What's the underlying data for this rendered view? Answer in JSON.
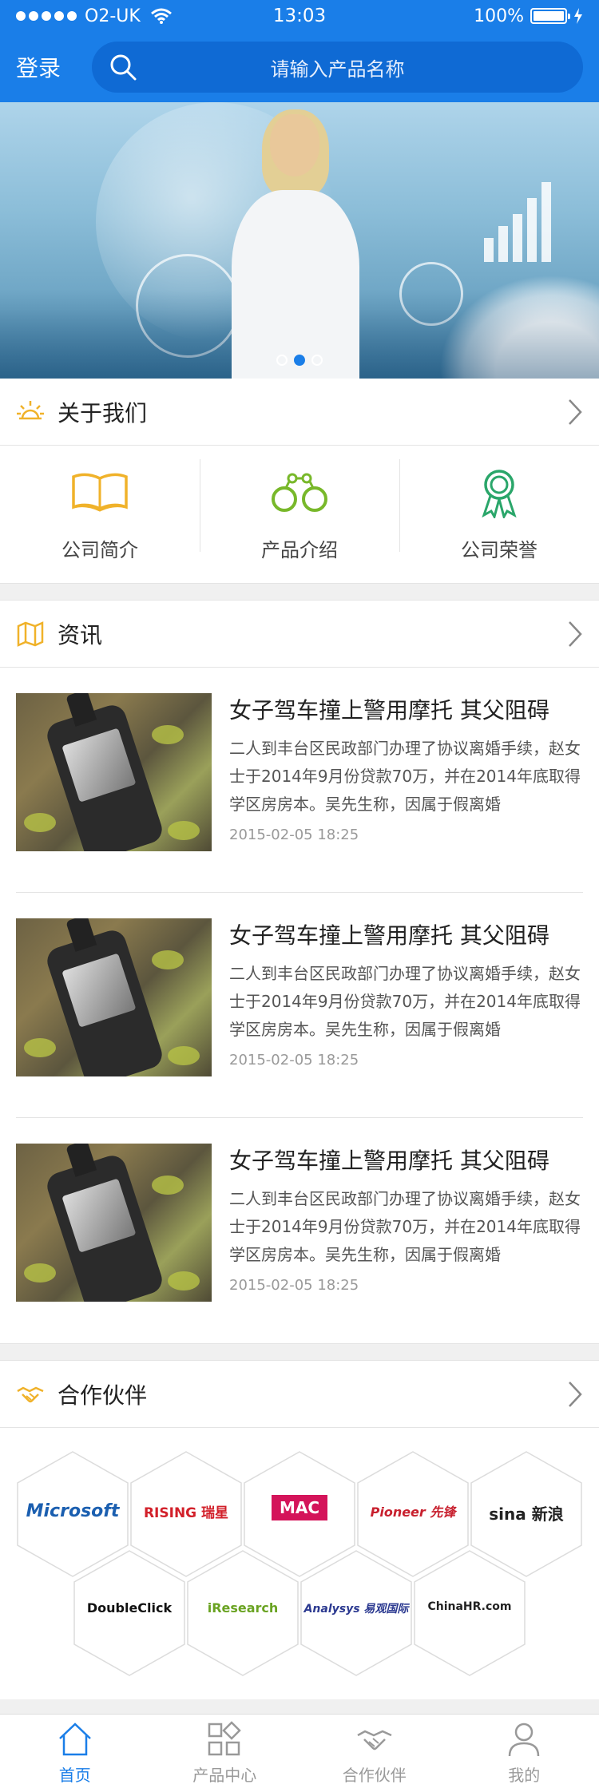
{
  "status_bar": {
    "carrier": "O2-UK",
    "time": "13:03",
    "battery": "100%"
  },
  "header": {
    "login_label": "登录",
    "search_placeholder": "请输入产品名称"
  },
  "banner": {
    "slides": 3,
    "active_slide": 2
  },
  "about": {
    "title": "关于我们",
    "items": [
      {
        "label": "公司简介",
        "icon": "book-icon"
      },
      {
        "label": "产品介绍",
        "icon": "handcuffs-icon"
      },
      {
        "label": "公司荣誉",
        "icon": "award-ribbon-icon"
      }
    ]
  },
  "news": {
    "title": "资讯",
    "items": [
      {
        "title": "女子驾车撞上警用摩托 其父阻碍",
        "desc_line1": "二人到丰台区民政部门办理了协议离婚手续，赵女",
        "desc_line2": "士于2014年9月份贷款70万，并在2014年底取得",
        "desc_line3": "学区房房本。吴先生称，因属于假离婚",
        "date": "2015-02-05  18:25"
      },
      {
        "title": "女子驾车撞上警用摩托 其父阻碍",
        "desc_line1": "二人到丰台区民政部门办理了协议离婚手续，赵女",
        "desc_line2": "士于2014年9月份贷款70万，并在2014年底取得",
        "desc_line3": "学区房房本。吴先生称，因属于假离婚",
        "date": "2015-02-05  18:25"
      },
      {
        "title": "女子驾车撞上警用摩托 其父阻碍",
        "desc_line1": "二人到丰台区民政部门办理了协议离婚手续，赵女",
        "desc_line2": "士于2014年9月份贷款70万，并在2014年底取得",
        "desc_line3": "学区房房本。吴先生称，因属于假离婚",
        "date": "2015-02-05  18:25"
      }
    ]
  },
  "partners": {
    "title": "合作伙伴",
    "logos": [
      "Microsoft",
      "RISING 瑞星",
      "MAC",
      "Pioneer 先锋",
      "sina 新浪",
      "DoubleClick",
      "iResearch",
      "Analysys 易观国际",
      "ChinaHR.com"
    ]
  },
  "tabbar": {
    "items": [
      {
        "label": "首页",
        "icon": "home-icon",
        "active": true
      },
      {
        "label": "产品中心",
        "icon": "grid-icon",
        "active": false
      },
      {
        "label": "合作伙伴",
        "icon": "handshake-icon",
        "active": false
      },
      {
        "label": "我的",
        "icon": "user-icon",
        "active": false
      }
    ]
  },
  "colors": {
    "primary": "#1a7ee8",
    "icon_yellow": "#f0b22a",
    "icon_green": "#78b82a",
    "icon_teal": "#2aa66a"
  }
}
